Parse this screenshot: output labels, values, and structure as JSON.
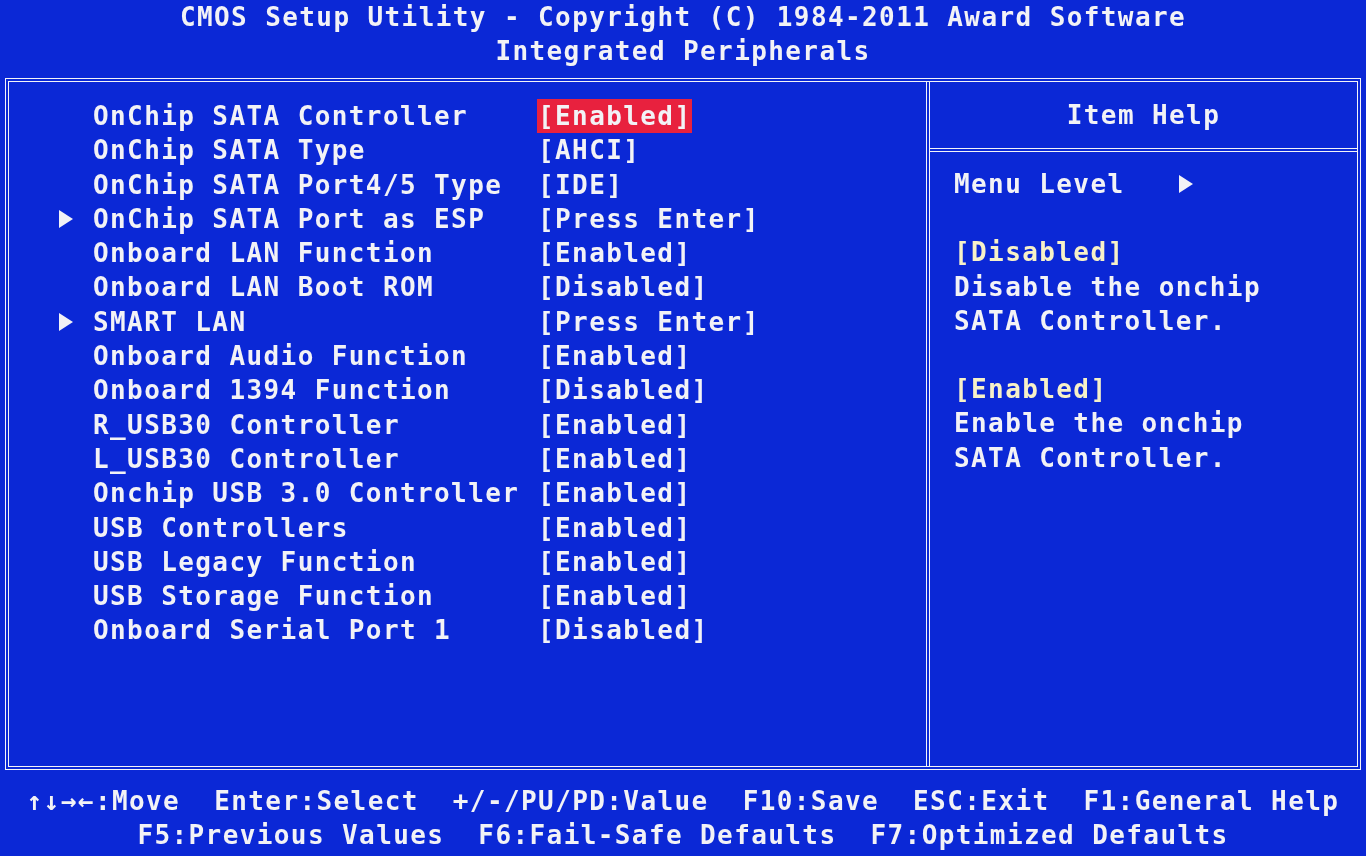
{
  "header": {
    "title": "CMOS Setup Utility - Copyright (C) 1984-2011 Award Software",
    "subtitle": "Integrated Peripherals"
  },
  "items": [
    {
      "label": "OnChip SATA Controller",
      "value": "[Enabled]",
      "submenu": false,
      "selected": true
    },
    {
      "label": "OnChip SATA Type",
      "value": "[AHCI]",
      "submenu": false,
      "selected": false
    },
    {
      "label": "OnChip SATA Port4/5 Type",
      "value": "[IDE]",
      "submenu": false,
      "selected": false
    },
    {
      "label": "OnChip SATA Port as ESP",
      "value": "[Press Enter]",
      "submenu": true,
      "selected": false
    },
    {
      "label": "Onboard LAN Function",
      "value": "[Enabled]",
      "submenu": false,
      "selected": false
    },
    {
      "label": "Onboard LAN Boot ROM",
      "value": "[Disabled]",
      "submenu": false,
      "selected": false
    },
    {
      "label": "SMART LAN",
      "value": "[Press Enter]",
      "submenu": true,
      "selected": false
    },
    {
      "label": "Onboard Audio Function",
      "value": "[Enabled]",
      "submenu": false,
      "selected": false
    },
    {
      "label": "Onboard 1394 Function",
      "value": "[Disabled]",
      "submenu": false,
      "selected": false
    },
    {
      "label": "R_USB30 Controller",
      "value": "[Enabled]",
      "submenu": false,
      "selected": false
    },
    {
      "label": "L_USB30 Controller",
      "value": "[Enabled]",
      "submenu": false,
      "selected": false
    },
    {
      "label": "Onchip USB 3.0 Controller",
      "value": "[Enabled]",
      "submenu": false,
      "selected": false
    },
    {
      "label": "USB Controllers",
      "value": "[Enabled]",
      "submenu": false,
      "selected": false
    },
    {
      "label": "USB Legacy Function",
      "value": "[Enabled]",
      "submenu": false,
      "selected": false
    },
    {
      "label": "USB Storage Function",
      "value": "[Enabled]",
      "submenu": false,
      "selected": false
    },
    {
      "label": "Onboard Serial Port 1",
      "value": "[Disabled]",
      "submenu": false,
      "selected": false
    }
  ],
  "help": {
    "title": "Item Help",
    "menu_level": "Menu Level",
    "options": [
      {
        "option": "[Disabled]",
        "lines": [
          "Disable the onchip",
          "SATA Controller."
        ]
      },
      {
        "option": "[Enabled]",
        "lines": [
          "Enable the onchip",
          "SATA Controller."
        ]
      }
    ]
  },
  "footer": [
    [
      "↑↓→←:Move",
      "Enter:Select",
      "+/-/PU/PD:Value",
      "F10:Save",
      "ESC:Exit",
      "F1:General Help"
    ],
    [
      "F5:Previous Values",
      "F6:Fail-Safe Defaults",
      "F7:Optimized Defaults"
    ]
  ]
}
